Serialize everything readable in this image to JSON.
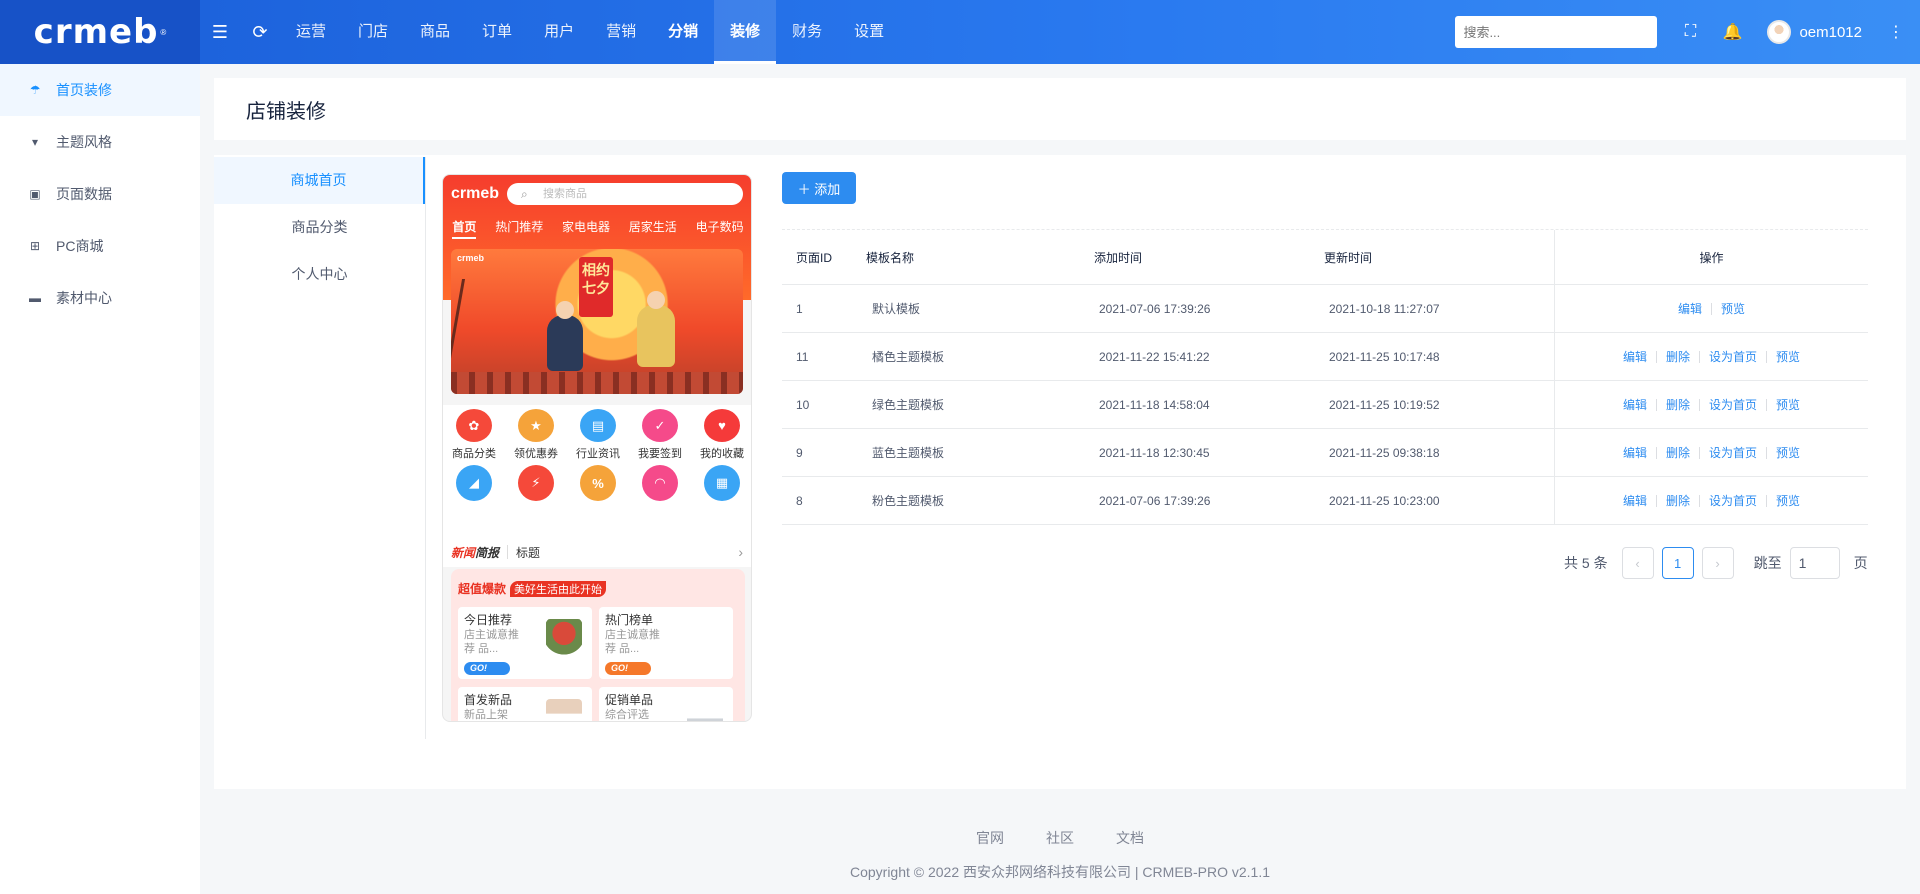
{
  "brand": {
    "logo": "crmeb",
    "trademark": "®"
  },
  "topnav": {
    "items": [
      {
        "label": "运营"
      },
      {
        "label": "门店"
      },
      {
        "label": "商品"
      },
      {
        "label": "订单"
      },
      {
        "label": "用户"
      },
      {
        "label": "营销"
      },
      {
        "label": "分销"
      },
      {
        "label": "装修"
      },
      {
        "label": "财务"
      },
      {
        "label": "设置"
      }
    ],
    "active": "装修",
    "search_placeholder": "搜索...",
    "username": "oem1012"
  },
  "sidebar": {
    "items": [
      {
        "label": "首页装修",
        "icon": "umbrella-icon",
        "glyph": "☂"
      },
      {
        "label": "主题风格",
        "icon": "shirt-icon",
        "glyph": "👕"
      },
      {
        "label": "页面数据",
        "icon": "copy-icon",
        "glyph": "▣"
      },
      {
        "label": "PC商城",
        "icon": "windows-icon",
        "glyph": "⊞"
      },
      {
        "label": "素材中心",
        "icon": "folder-icon",
        "glyph": "▬"
      }
    ]
  },
  "page_title": "店铺装修",
  "sub_menu": {
    "items": [
      "商城首页",
      "商品分类",
      "个人中心"
    ]
  },
  "phone_preview": {
    "logo": "crmeb",
    "search_placeholder": "搜索商品",
    "tabs": [
      "首页",
      "热门推荐",
      "家电电器",
      "居家生活",
      "电子数码"
    ],
    "banner_logo": "crmeb",
    "banner_title": "相约七夕",
    "icons": [
      {
        "label": "商品分类",
        "color": "#f5493a"
      },
      {
        "label": "领优惠券",
        "color": "#f5a33a"
      },
      {
        "label": "行业资讯",
        "color": "#3aa5f5"
      },
      {
        "label": "我要签到",
        "color": "#f54a8a"
      },
      {
        "label": "我的收藏",
        "color": "#f53a3a"
      }
    ],
    "icons_row2": [
      {
        "color": "#3aa5f5"
      },
      {
        "color": "#f5493a"
      },
      {
        "color": "#f5a33a"
      },
      {
        "color": "#f54a8a"
      },
      {
        "color": "#3aa5f5"
      }
    ],
    "news_tag_red": "新闻",
    "news_tag_dark": "简报",
    "news_text": "标题",
    "promo_title": "超值爆款",
    "promo_slogan": "美好生活由此开始",
    "cards": [
      {
        "title": "今日推荐",
        "sub": "店主诚意推荐 品...",
        "go": "GO!",
        "go_color": "#2d8cf0"
      },
      {
        "title": "热门榜单",
        "sub": "店主诚意推荐 品...",
        "go": "GO!",
        "go_color": "#f5782a"
      },
      {
        "title": "首发新品",
        "sub": "新品上架"
      },
      {
        "title": "促销单品",
        "sub": "综合评选"
      }
    ]
  },
  "add_button": "添加",
  "table": {
    "headers": [
      "页面ID",
      "模板名称",
      "添加时间",
      "更新时间",
      "操作"
    ],
    "rows": [
      {
        "id": "1",
        "name": "默认模板",
        "added": "2021-07-06 17:39:26",
        "updated": "2021-10-18 11:27:07",
        "ops": [
          "编辑",
          "预览"
        ]
      },
      {
        "id": "11",
        "name": "橘色主题模板",
        "added": "2021-11-22 15:41:22",
        "updated": "2021-11-25 10:17:48",
        "ops": [
          "编辑",
          "删除",
          "设为首页",
          "预览"
        ]
      },
      {
        "id": "10",
        "name": "绿色主题模板",
        "added": "2021-11-18 14:58:04",
        "updated": "2021-11-25 10:19:52",
        "ops": [
          "编辑",
          "删除",
          "设为首页",
          "预览"
        ]
      },
      {
        "id": "9",
        "name": "蓝色主题模板",
        "added": "2021-11-18 12:30:45",
        "updated": "2021-11-25 09:38:18",
        "ops": [
          "编辑",
          "删除",
          "设为首页",
          "预览"
        ]
      },
      {
        "id": "8",
        "name": "粉色主题模板",
        "added": "2021-07-06 17:39:26",
        "updated": "2021-11-25 10:23:00",
        "ops": [
          "编辑",
          "删除",
          "设为首页",
          "预览"
        ]
      }
    ]
  },
  "pagination": {
    "total": "共 5 条",
    "current": "1",
    "jump_label": "跳至",
    "jump_value": "1",
    "unit": "页"
  },
  "footer": {
    "links": [
      "官网",
      "社区",
      "文档"
    ],
    "copyright": "Copyright © 2022 西安众邦网络科技有限公司 | CRMEB-PRO v2.1.1"
  },
  "colors": {
    "primary": "#2d8cf0",
    "topbar": "#2a7af0",
    "accent_red": "#e93323"
  }
}
